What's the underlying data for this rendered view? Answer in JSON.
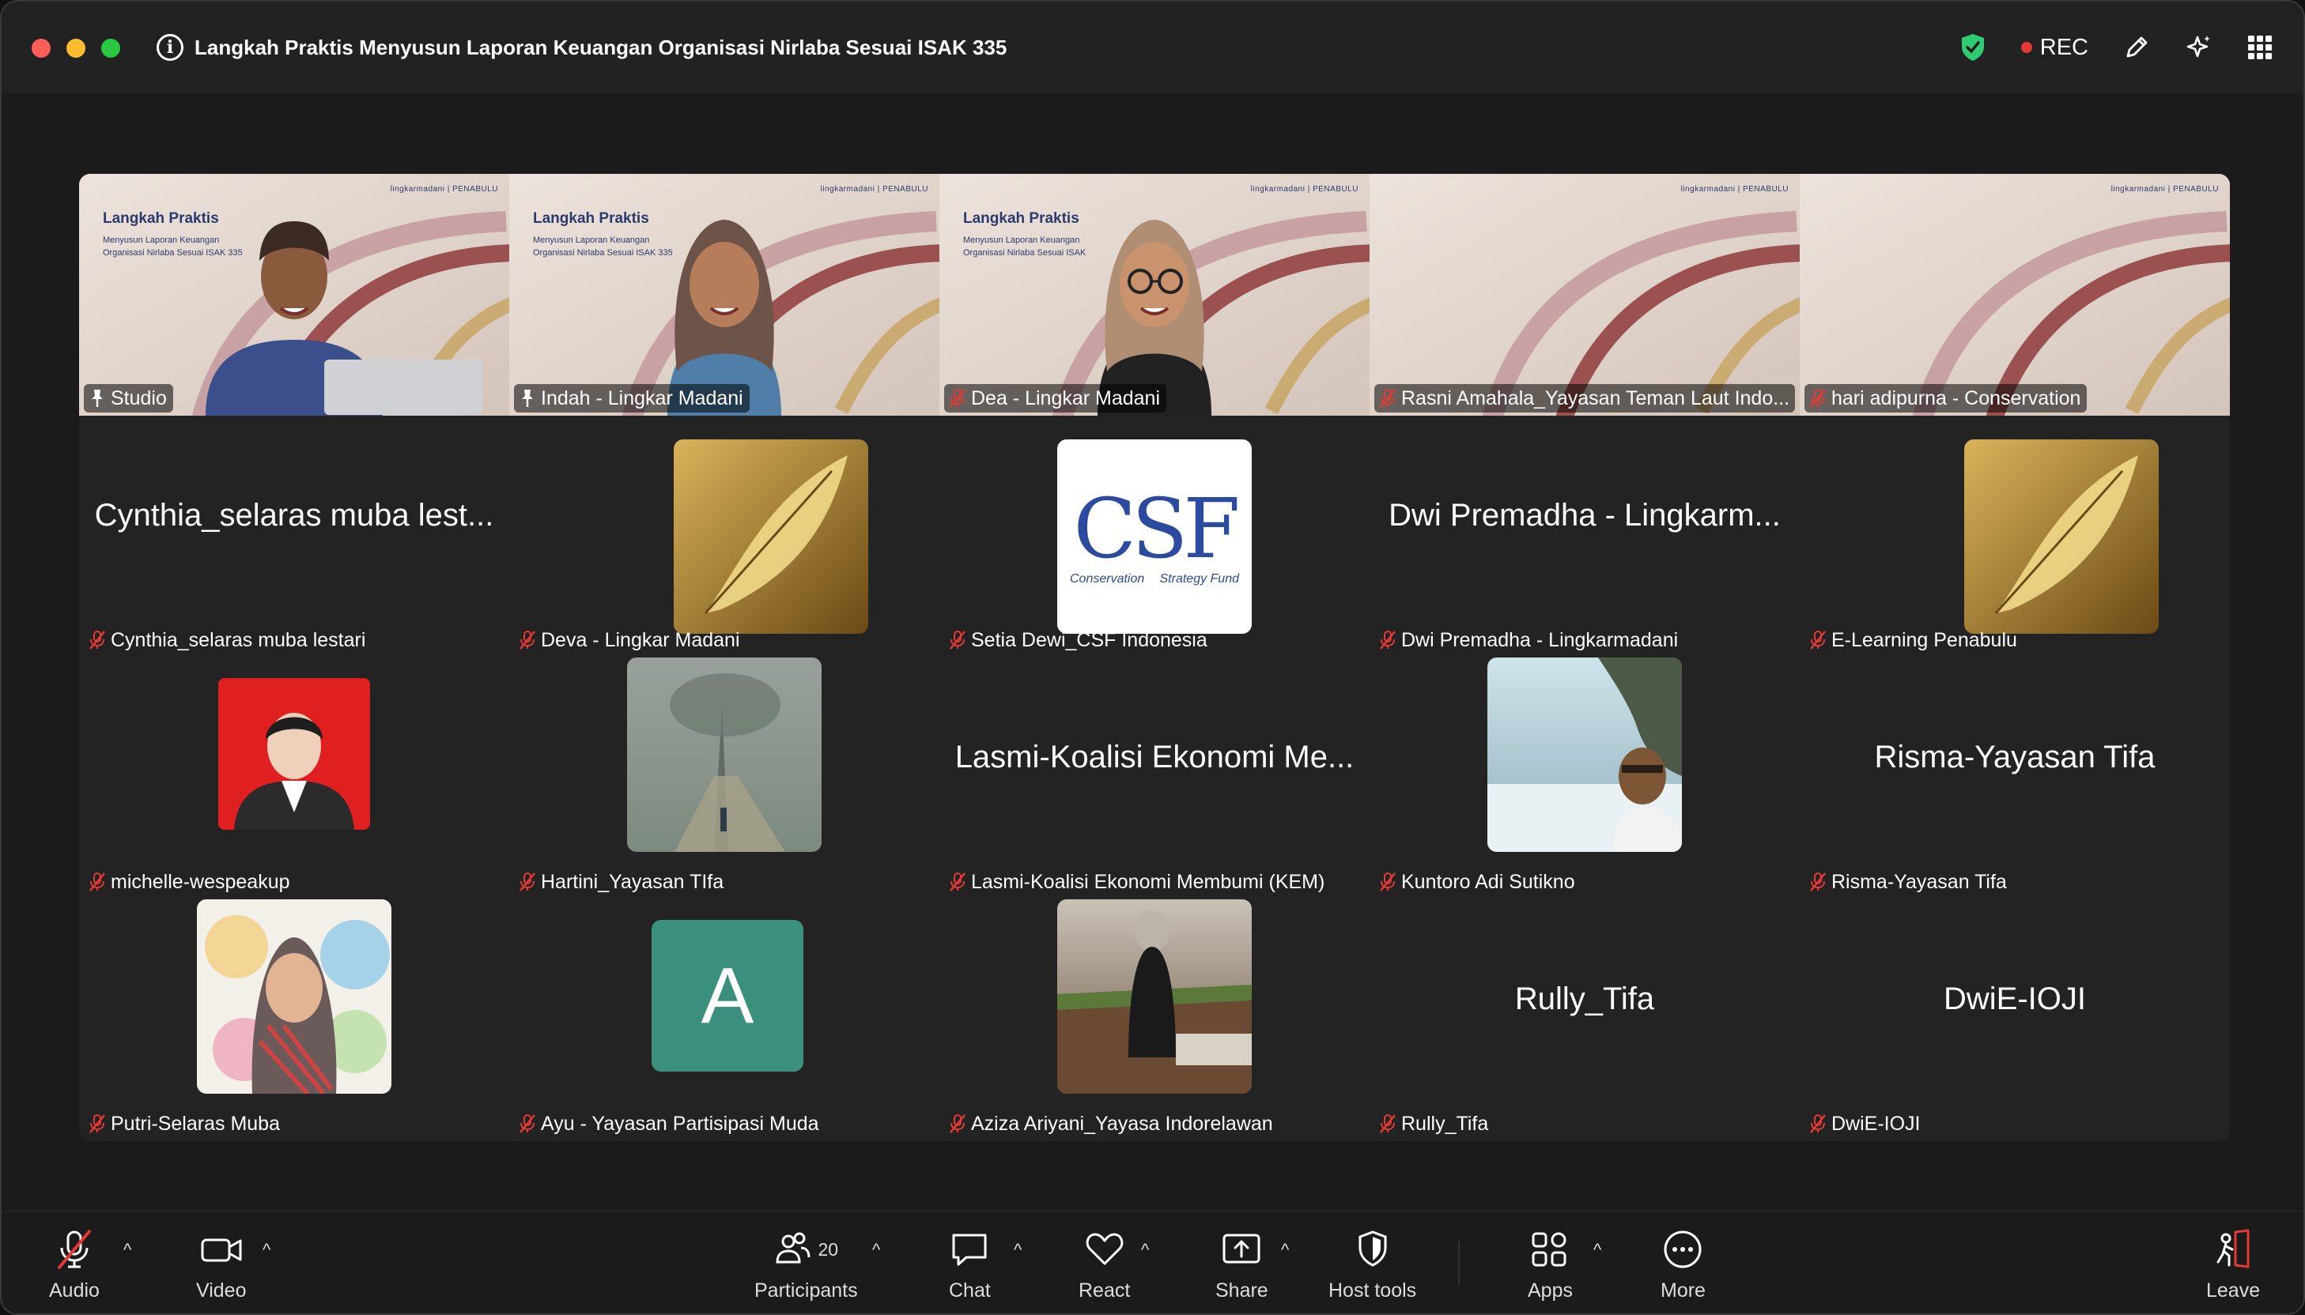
{
  "window": {
    "title": "Langkah Praktis Menyusun Laporan Keuangan Organisasi Nirlaba Sesuai ISAK 335",
    "rec_label": "REC",
    "colors": {
      "close": "#ff5f57",
      "min": "#febc2e",
      "max": "#28c840",
      "active_speaker": "#2fd05f",
      "shield": "#2ecc71"
    }
  },
  "slide": {
    "title": "Langkah Praktis",
    "subtitle": "Menyusun Laporan Keuangan Organisasi Nirlaba Sesuai ISAK 335",
    "subtitle_cropped": "Menyusun Laporan Keuangan Organisasi Nirlaba Sesuai ISAK",
    "logo_text": "lingkarmadani  |  PENABULU"
  },
  "participants": [
    {
      "name": "Studio",
      "display": "",
      "state": "pinned",
      "kind": "video"
    },
    {
      "name": "Indah - Lingkar Madani",
      "display": "",
      "state": "pinned",
      "kind": "video",
      "active": true
    },
    {
      "name": "Dea - Lingkar Madani",
      "display": "",
      "state": "muted",
      "kind": "video"
    },
    {
      "name": "Rasni Amahala_Yayasan Teman Laut Indo...",
      "display": "",
      "state": "muted",
      "kind": "slide"
    },
    {
      "name": "hari adipurna - Conservation",
      "display": "",
      "state": "muted",
      "kind": "slide"
    },
    {
      "name": "Cynthia_selaras muba lestari",
      "display": "Cynthia_selaras muba lest...",
      "state": "muted",
      "kind": "text"
    },
    {
      "name": "Deva - Lingkar Madani",
      "display": "",
      "state": "muted",
      "kind": "feather"
    },
    {
      "name": "Setia Dewi_CSF Indonesia",
      "display": "",
      "state": "muted",
      "kind": "csf"
    },
    {
      "name": "Dwi Premadha - Lingkarmadani",
      "display": "Dwi Premadha - Lingkarm...",
      "state": "muted",
      "kind": "text"
    },
    {
      "name": "E-Learning Penabulu",
      "display": "",
      "state": "muted",
      "kind": "feather"
    },
    {
      "name": "michelle-wespeakup",
      "display": "",
      "state": "muted",
      "kind": "photo-red"
    },
    {
      "name": "Hartini_Yayasan TIfa",
      "display": "",
      "state": "muted",
      "kind": "photo-fog"
    },
    {
      "name": "Lasmi-Koalisi Ekonomi Membumi (KEM)",
      "display": "Lasmi-Koalisi Ekonomi Me...",
      "state": "muted",
      "kind": "text"
    },
    {
      "name": "Kuntoro Adi Sutikno",
      "display": "",
      "state": "muted",
      "kind": "photo-sea"
    },
    {
      "name": "Risma-Yayasan Tifa",
      "display": "Risma-Yayasan Tifa",
      "state": "muted",
      "kind": "text"
    },
    {
      "name": "Putri-Selaras Muba",
      "display": "",
      "state": "muted",
      "kind": "photo-art"
    },
    {
      "name": "Ayu - Yayasan Partisipasi Muda",
      "display": "A",
      "state": "muted",
      "kind": "letter"
    },
    {
      "name": "Aziza Ariyani_Yayasa Indorelawan",
      "display": "",
      "state": "muted",
      "kind": "photo-field"
    },
    {
      "name": "Rully_Tifa",
      "display": "Rully_Tifa",
      "state": "muted",
      "kind": "text"
    },
    {
      "name": "DwiE-IOJI",
      "display": "DwiE-IOJI",
      "state": "muted",
      "kind": "text"
    }
  ],
  "csf_logo": {
    "letters": "CSF",
    "left": "Conservation",
    "right": "Strategy Fund"
  },
  "toolbar": {
    "audio": "Audio",
    "video": "Video",
    "participants": "Participants",
    "participant_count": "20",
    "chat": "Chat",
    "react": "React",
    "share": "Share",
    "host_tools": "Host tools",
    "apps": "Apps",
    "more": "More",
    "leave": "Leave"
  }
}
